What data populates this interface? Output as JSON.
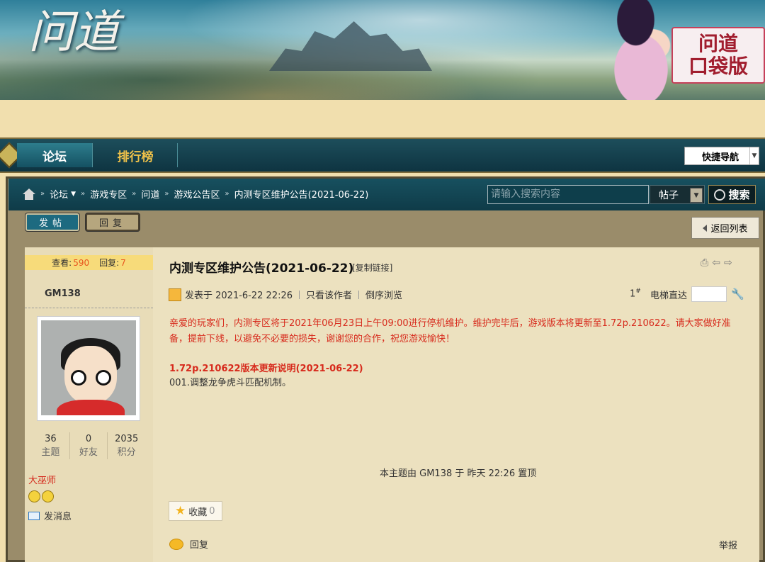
{
  "banner": {
    "logo_text": "问道",
    "seal_line1": "问道",
    "seal_line2": "口袋版"
  },
  "nav": {
    "tabs": [
      {
        "label": "论坛"
      },
      {
        "label": "排行榜"
      }
    ],
    "quick_nav": "快捷导航"
  },
  "breadcrumb": [
    "论坛",
    "游戏专区",
    "问道",
    "游戏公告区",
    "内测专区维护公告(2021-06-22)"
  ],
  "search": {
    "placeholder": "请输入搜索内容",
    "type": "帖子",
    "button": "搜索"
  },
  "actions": {
    "post": "发帖",
    "reply": "回复",
    "back": "返回列表"
  },
  "thread_stats": {
    "views_label": "查看:",
    "views": "590",
    "replies_label": "回复:",
    "replies": "7"
  },
  "author": {
    "name": "GM138",
    "stats": [
      {
        "value": "36",
        "label": "主题"
      },
      {
        "value": "0",
        "label": "好友"
      },
      {
        "value": "2035",
        "label": "积分"
      }
    ],
    "rank": "大巫师",
    "send_message": "发消息"
  },
  "post": {
    "title": "内测专区维护公告(2021-06-22)",
    "copy_link": "[复制链接]",
    "posted_at": "发表于 2021-6-22 22:26",
    "only_author": "只看该作者",
    "reverse_order": "倒序浏览",
    "floor": "1",
    "floor_mark": "#",
    "elevator": "电梯直达",
    "notice": "亲爱的玩家们，内测专区将于2021年06月23日上午09:00进行停机维护。维护完毕后，游戏版本将更新至1.72p.210622。请大家做好准备，提前下线，以避免不必要的损失，谢谢您的合作，祝您游戏愉快！",
    "update_title": "1.72p.210622版本更新说明(2021-06-22)",
    "update_item": "001.调整龙争虎斗匹配机制。",
    "pinned_note": "本主题由 GM138 于 昨天 22:26 置顶",
    "favorite_label": "收藏",
    "favorite_count": "0",
    "reply_label": "回复",
    "report_label": "举报"
  }
}
